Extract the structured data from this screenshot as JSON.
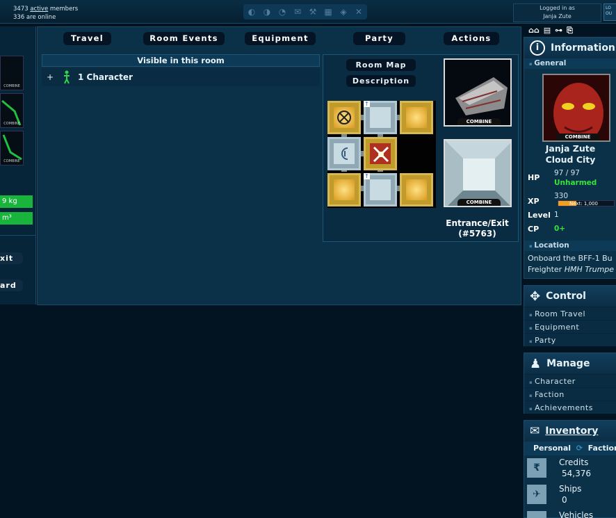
{
  "top": {
    "members_prefix": "3473",
    "members_link": "active",
    "members_suffix": "members",
    "online": "336 are online",
    "logged_in_label": "Logged in as",
    "username": "Janja Zute",
    "logout_label": "LO OU"
  },
  "left": {
    "thumb_logo": "COMBINE",
    "weight": "9 kg",
    "volume": "m³",
    "exit_btn": "xit",
    "board_btn": "ard"
  },
  "nav": {
    "travel": "Travel",
    "room_events": "Room Events",
    "equipment": "Equipment",
    "party": "Party",
    "actions": "Actions"
  },
  "room": {
    "visible_title": "Visible in this room",
    "expand": "+",
    "character_count": "1 Character",
    "room_map_btn": "Room Map",
    "description_btn": "Description",
    "combine_logo": "COMBINE",
    "exit_name": "Entrance/Exit",
    "exit_id": "(#5763)"
  },
  "sidebar": {
    "information_title": "Information",
    "general": "General",
    "char_name": "Janja Zute",
    "char_location": "Cloud City",
    "hp_label": "HP",
    "hp_value": "97 / 97",
    "hp_status": "Unharmed",
    "xp_label": "XP",
    "xp_value": "330",
    "xp_next": "Next: 1,000",
    "xp_progress": 0.33,
    "level_label": "Level",
    "level_value": "1",
    "cp_label": "CP",
    "cp_value": "0+",
    "location_title": "Location",
    "location_line1": "Onboard the BFF-1 Bu",
    "location_line2_prefix": "Freighter ",
    "location_line2_italic": "HMH Trumpe",
    "control_title": "Control",
    "control_items": [
      "Room Travel",
      "Equipment",
      "Party"
    ],
    "manage_title": "Manage",
    "manage_items": [
      "Character",
      "Faction",
      "Achievements"
    ],
    "inventory_title": "Inventory",
    "inv_tab_personal": "Personal",
    "inv_tab_faction": "Faction",
    "credits_label": "Credits",
    "credits_value": "54,376",
    "ships_label": "Ships",
    "ships_value": "0",
    "vehicles_label": "Vehicles"
  },
  "colors": {
    "accent_green": "#19b43c",
    "status_green": "#39e23a",
    "xp_bar": "#f0a020",
    "panel_bg": "#0b3148"
  }
}
